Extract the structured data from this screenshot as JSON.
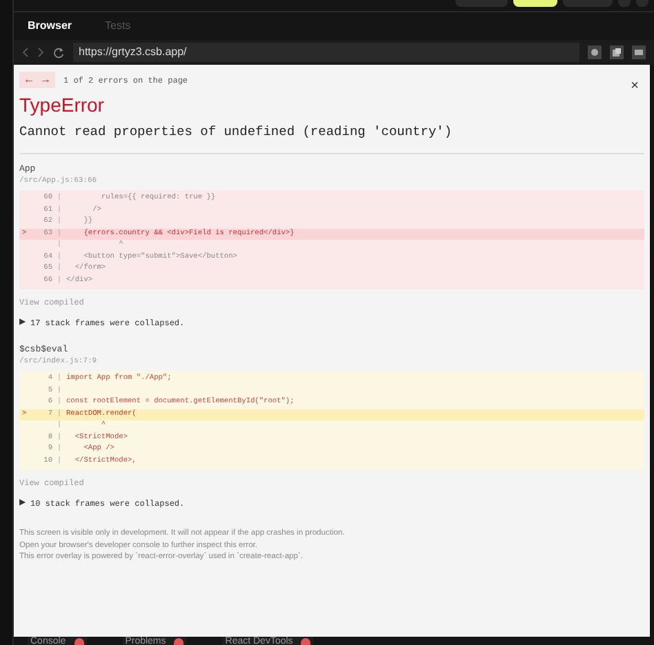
{
  "browser_tabs": [
    {
      "label": "Browser",
      "selected": true
    },
    {
      "label": "Tests",
      "selected": false
    }
  ],
  "address_bar": {
    "url": "https://grtyz3.csb.app/"
  },
  "overlay": {
    "nav": {
      "prev": "←",
      "next": "→",
      "counter": "1 of 2 errors on the page"
    },
    "close": "×",
    "error_type": "TypeError",
    "message": "Cannot read properties of undefined (reading 'country')",
    "frames": [
      {
        "kind": "app",
        "name": "App",
        "file": "/src/App.js:63:66",
        "view_compiled": "View compiled",
        "collapsed": "17 stack frames were collapsed.",
        "collapse_icon": "▶",
        "lines": [
          {
            "number": "60",
            "gutter": "|",
            "code": "        rules={{ required: true }}",
            "highlighted": false
          },
          {
            "number": "61",
            "gutter": "|",
            "code": "      />",
            "highlighted": false
          },
          {
            "number": "62",
            "gutter": "|",
            "code": "    }}",
            "highlighted": false
          },
          {
            "marker": ">",
            "number": "63",
            "gutter": "|",
            "code": "    {errors.country && <div>Field is required</div>}",
            "highlighted": true
          },
          {
            "gutter": "|",
            "code": "            ^",
            "highlighted": false
          },
          {
            "number": "64",
            "gutter": "|",
            "code": "    <button type=\"submit\">Save</button>",
            "highlighted": false
          },
          {
            "number": "65",
            "gutter": "|",
            "code": "  </form>",
            "highlighted": false
          },
          {
            "number": "66",
            "gutter": "|",
            "code": "</div>",
            "highlighted": false
          }
        ]
      },
      {
        "kind": "library",
        "name": "$csb$eval",
        "file": "/src/index.js:7:9",
        "view_compiled": "View compiled",
        "collapsed": "10 stack frames were collapsed.",
        "collapse_icon": "▶",
        "lines": [
          {
            "number": "4",
            "gutter": "|",
            "code": "import App from \"./App\";",
            "highlighted": false
          },
          {
            "number": "5",
            "gutter": "|",
            "highlighted": false
          },
          {
            "number": "6",
            "gutter": "|",
            "code": "const rootElement = document.getElementById(\"root\");",
            "highlighted": false
          },
          {
            "marker": ">",
            "number": "7",
            "gutter": "|",
            "code": "ReactDOM.render(",
            "highlighted": true
          },
          {
            "gutter": "|",
            "code": "        ^",
            "highlighted": false
          },
          {
            "number": "8",
            "gutter": "|",
            "code": "  <StrictMode>",
            "highlighted": false
          },
          {
            "number": "9",
            "gutter": "|",
            "code": "    <App />",
            "highlighted": false
          },
          {
            "number": "10",
            "gutter": "|",
            "code": "  </StrictMode>,",
            "highlighted": false
          }
        ]
      }
    ],
    "footer": [
      "This screen is visible only in development. It will not appear if the app crashes in production.",
      "Open your browser's developer console to further inspect this error.",
      "This error overlay is powered by `react-error-overlay` used in `create-react-app`."
    ]
  },
  "bottom_tabs": [
    {
      "label": "Console"
    },
    {
      "label": "Problems"
    },
    {
      "label": "React DevTools"
    }
  ]
}
